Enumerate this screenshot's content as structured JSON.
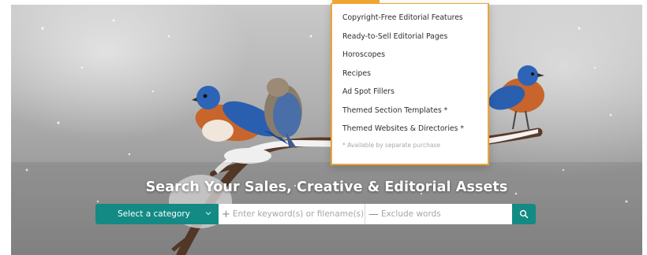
{
  "hero": {
    "title": "Search Your Sales, Creative & Editorial Assets",
    "image_alt": "bluebirds perched on snowy branch"
  },
  "search": {
    "category_label": "Select a category",
    "keyword_placeholder": "Enter keyword(s) or filename(s)",
    "exclude_placeholder": "Exclude words",
    "accent_color": "#138a84"
  },
  "dropdown": {
    "items": [
      "Copyright-Free Editorial Features",
      "Ready-to-Sell Editorial Pages",
      "Horoscopes",
      "Recipes",
      "Ad Spot Fillers",
      "Themed Section Templates *",
      "Themed Websites & Directories *"
    ],
    "note": "* Available by separate purchase",
    "border_color": "#f0a431"
  }
}
